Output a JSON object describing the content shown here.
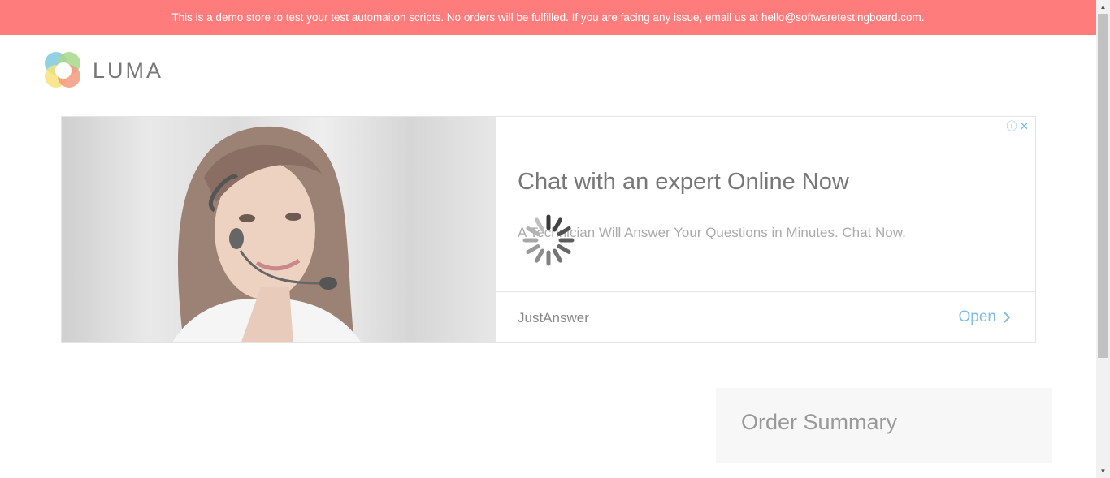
{
  "banner": {
    "text": "This is a demo store to test your test automaiton scripts. No orders will be fulfilled. If you are facing any issue, email us at hello@softwaretestingboard.com."
  },
  "logo": {
    "text": "LUMA"
  },
  "ad": {
    "choices_icon": "info-icon",
    "close_icon": "close-icon",
    "headline": "Chat with an expert Online Now",
    "description": "A Technician Will Answer Your Questions in Minutes. Chat Now.",
    "advertiser": "JustAnswer",
    "cta_label": "Open",
    "cta_color": "#7fbde8"
  },
  "loading": {
    "icon": "loading-spinner-icon"
  },
  "order_summary": {
    "title": "Order Summary"
  },
  "colors": {
    "banner": "#ff7c7c",
    "summary_bg": "#f7f7f7"
  }
}
